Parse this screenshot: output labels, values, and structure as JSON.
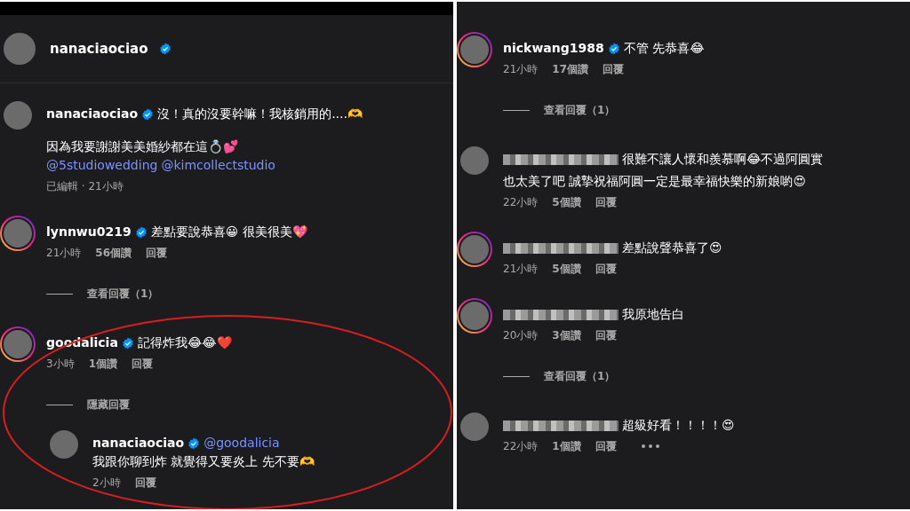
{
  "left": {
    "header": {
      "user": "nanaciaociao",
      "verified": true
    },
    "comments": [
      {
        "user": "nanaciaociao",
        "verified": true,
        "ring": false,
        "text": "沒！真的沒要幹嘛！我核銷用的....🫶",
        "line2": "因為我要謝謝美美婚紗都在這💍💕",
        "links": [
          "@5studiowedding",
          "@kimcollectstudio"
        ],
        "time": "已編輯 · 21小時"
      },
      {
        "user": "lynnwu0219",
        "verified": true,
        "ring": true,
        "text": "差點要說恭喜😀 很美很美💖",
        "time": "21小時",
        "likes": "56個讚",
        "reply": "回覆",
        "toggle": "查看回覆（1）"
      },
      {
        "user": "goodalicia",
        "verified": true,
        "ring": true,
        "text": "記得炸我😂😂❤️",
        "time": "3小時",
        "likes": "1個讚",
        "reply": "回覆",
        "toggle": "隱藏回覆",
        "children": [
          {
            "user": "nanaciaociao",
            "verified": true,
            "ring": false,
            "mention": "@goodalicia",
            "text": "我跟你聊到炸 就覺得又要炎上 先不要🫶",
            "time": "2小時",
            "reply": "回覆"
          }
        ]
      }
    ]
  },
  "right": {
    "comments": [
      {
        "user": "nickwang1988",
        "verified": true,
        "ring": true,
        "text": "不管 先恭喜😂",
        "time": "21小時",
        "likes": "17個讚",
        "reply": "回覆",
        "toggle": "查看回覆（1）"
      },
      {
        "blurred": true,
        "ring": false,
        "text": "很難不讓人懷和羨慕啊😂不過阿圓實",
        "line2": "也太美了吧 誠摯祝福阿圓一定是最幸福快樂的新娘喲😍",
        "time": "22小時",
        "likes": "5個讚",
        "reply": "回覆"
      },
      {
        "blurred": true,
        "ring": true,
        "text": "差點說聲恭喜了😍",
        "time": "21小時",
        "likes": "5個讚",
        "reply": "回覆"
      },
      {
        "blurred": true,
        "ring": true,
        "text": "我原地告白",
        "time": "20小時",
        "likes": "3個讚",
        "reply": "回覆",
        "toggle": "查看回覆（1）"
      },
      {
        "blurred": true,
        "ring": false,
        "text": "超級好看！！！！😍",
        "time": "22小時",
        "likes": "1個讚",
        "reply": "回覆",
        "more": true
      }
    ]
  }
}
